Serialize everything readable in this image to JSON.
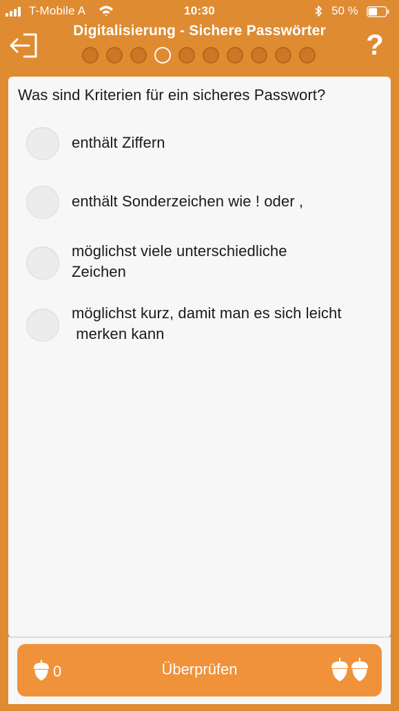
{
  "status_bar": {
    "carrier": "T-Mobile A",
    "time": "10:30",
    "battery": "50 %",
    "icons": [
      "signal-icon",
      "wifi-icon",
      "bluetooth-icon",
      "battery-icon"
    ]
  },
  "header": {
    "title": "Digitalisierung - Sichere Passwörter",
    "help_label": "?",
    "exit_icon": "exit-icon",
    "progress": {
      "total": 10,
      "current_index": 3
    }
  },
  "quiz": {
    "question": "Was sind Kriterien für ein sicheres Passwort?",
    "options": [
      {
        "label": "enthält Ziffern",
        "selected": false
      },
      {
        "label": "enthält Sonderzeichen wie ! oder ,",
        "selected": false
      },
      {
        "label": "möglichst viele unterschiedliche\nZeichen",
        "selected": false
      },
      {
        "label": "möglichst kurz, damit man es sich leicht\n merken kann",
        "selected": false
      }
    ]
  },
  "footer": {
    "check_label": "Überprüfen",
    "score": "0",
    "score_icon": "acorn-icon",
    "reward_icon": "acorns-icon"
  },
  "colors": {
    "background": "#df8b31",
    "button": "#f0923a",
    "card": "#f7f7f7",
    "text": "#1a1a1a"
  }
}
